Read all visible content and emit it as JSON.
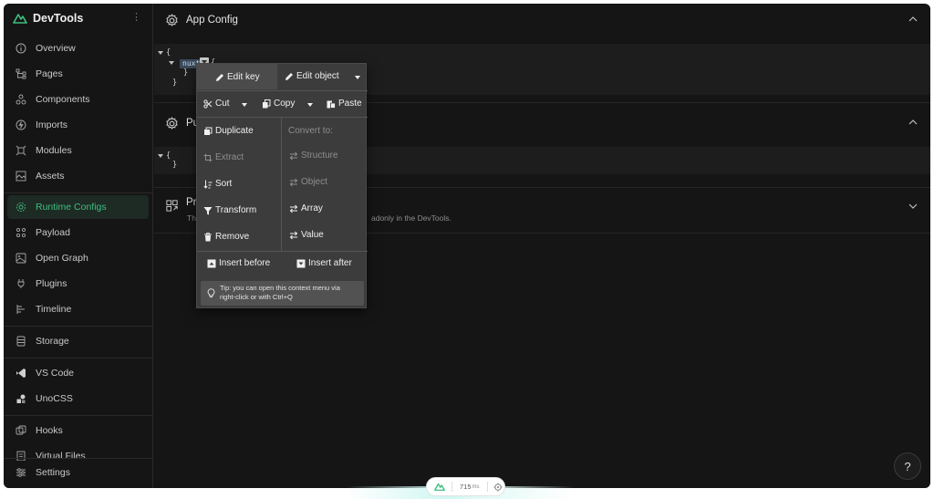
{
  "app": {
    "name": "DevTools"
  },
  "sidebar": {
    "items": [
      {
        "label": "Overview",
        "icon": "info-circle-icon"
      },
      {
        "label": "Pages",
        "icon": "tree-icon"
      },
      {
        "label": "Components",
        "icon": "components-icon"
      },
      {
        "label": "Imports",
        "icon": "imports-icon"
      },
      {
        "label": "Modules",
        "icon": "modules-icon"
      },
      {
        "label": "Assets",
        "icon": "assets-icon"
      },
      {
        "label": "Runtime Configs",
        "icon": "gear-icon",
        "active": true
      },
      {
        "label": "Payload",
        "icon": "payload-icon"
      },
      {
        "label": "Open Graph",
        "icon": "open-graph-icon"
      },
      {
        "label": "Plugins",
        "icon": "plug-icon"
      },
      {
        "label": "Timeline",
        "icon": "timeline-icon"
      },
      {
        "label": "Storage",
        "icon": "storage-icon"
      },
      {
        "label": "VS Code",
        "icon": "vscode-icon"
      },
      {
        "label": "UnoCSS",
        "icon": "unocss-icon"
      },
      {
        "label": "Hooks",
        "icon": "hooks-icon"
      },
      {
        "label": "Virtual Files",
        "icon": "file-icon"
      }
    ],
    "settings_label": "Settings"
  },
  "main": {
    "app_config": {
      "title": "App Config",
      "lines": [
        "{",
        "nuxt",
        "{",
        "}",
        "}"
      ]
    },
    "public_config": {
      "title": "Pu",
      "lines": [
        "{",
        "}"
      ]
    },
    "private_config": {
      "title": "Pri",
      "desc_start": "The",
      "desc_end": "adonly in the DevTools."
    }
  },
  "context_menu": {
    "edit_key": "Edit key",
    "edit_object": "Edit object",
    "cut": "Cut",
    "copy": "Copy",
    "paste": "Paste",
    "duplicate": "Duplicate",
    "extract": "Extract",
    "sort": "Sort",
    "transform": "Transform",
    "remove": "Remove",
    "convert_to": "Convert to:",
    "structure": "Structure",
    "object": "Object",
    "array": "Array",
    "value": "Value",
    "insert_before": "Insert before",
    "insert_after": "Insert after",
    "tip_line1": "Tip: you can open this context menu via",
    "tip_line2": "right-click or with Ctrl+Q"
  },
  "help": {
    "label": "?"
  },
  "status_pill": {
    "value": "715",
    "unit": "ms"
  },
  "colors": {
    "accent": "#3fbf80",
    "background": "#151515",
    "menu": "#3c3c3c"
  }
}
